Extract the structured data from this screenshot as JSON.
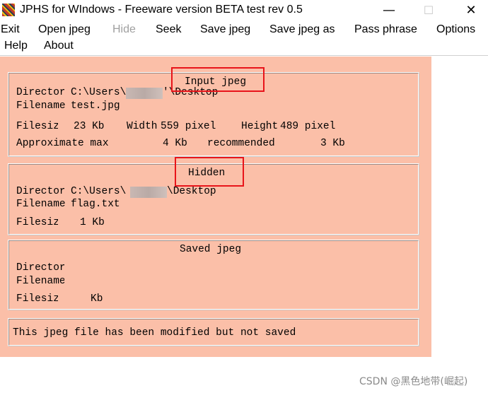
{
  "window": {
    "title": "JPHS for WIndows - Freeware version BETA test rev 0.5",
    "min_glyph": "—",
    "max_glyph": "☐",
    "close_glyph": "✕"
  },
  "menu": {
    "exit": "Exit",
    "open_jpeg": "Open jpeg",
    "hide": "Hide",
    "seek": "Seek",
    "save_jpeg": "Save jpeg",
    "save_jpeg_as": "Save jpeg as",
    "pass_phrase": "Pass phrase",
    "options": "Options",
    "help": "Help",
    "about": "About"
  },
  "input_panel": {
    "heading": "Input jpeg",
    "directory_label": "Directory",
    "directory_prefix": "C:\\Users\\",
    "directory_suffix": "'\\Desktop",
    "filename_label": "Filename",
    "filename_value": "test.jpg",
    "filesize_label": "Filesize",
    "filesize_value": "23 Kb",
    "width_label": "Width",
    "width_value": "559 pixel",
    "height_label": "Height",
    "height_value": "489 pixel",
    "approx_label": "Approximate max",
    "approx_value": "4 Kb",
    "recommended_label": "recommended",
    "recommended_value": "3 Kb"
  },
  "hidden_panel": {
    "heading": "Hidden",
    "directory_label": "Directory",
    "directory_prefix": "C:\\Users\\",
    "directory_suffix": "\\Desktop",
    "filename_label": "Filename",
    "filename_value": "flag.txt",
    "filesize_label": "Filesize",
    "filesize_value": "1 Kb"
  },
  "saved_panel": {
    "heading": "Saved jpeg",
    "directory_label": "Directory",
    "filename_label": "Filename",
    "filesize_label": "Filesize",
    "filesize_value": "Kb"
  },
  "status": {
    "message": "This jpeg file has been modified but not saved"
  },
  "watermark": "CSDN @黑色地带(崛起)",
  "colors": {
    "client_bg": "#fbbfa8",
    "highlight_box": "#e8141a"
  }
}
